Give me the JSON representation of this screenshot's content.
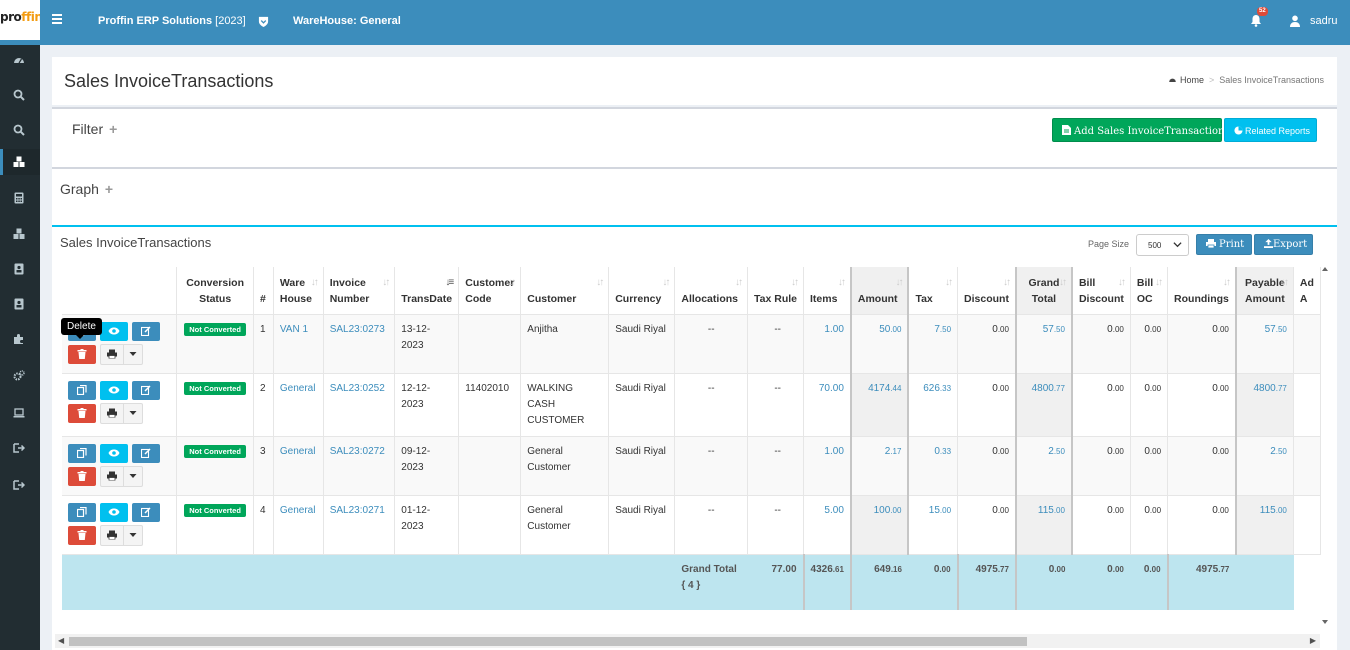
{
  "topbar": {
    "logo_a": "pro",
    "logo_b": "ffin",
    "title": "Proffin ERP Solutions",
    "year": "[2023]",
    "warehouse": "WareHouse: General",
    "notifications": "52",
    "user": "sadru"
  },
  "sidebar": {
    "icons": [
      "dashboard-icon",
      "search-icon",
      "search-icon",
      "cubes-icon",
      "calculator-icon",
      "cubes-icon",
      "id-card-icon",
      "id-card-icon",
      "puzzle-icon",
      "cogs-icon",
      "laptop-icon",
      "sign-out-icon",
      "sign-out-icon"
    ]
  },
  "header": {
    "title": "Sales InvoiceTransactions",
    "breadcrumb_home": "Home",
    "breadcrumb_sep": ">",
    "breadcrumb_current": "Sales InvoiceTransactions"
  },
  "filter": {
    "title": "Filter",
    "plus": "+",
    "add_button": "Add Sales InvoiceTransactions",
    "reports_button": "Related Reports"
  },
  "graph": {
    "title": "Graph",
    "plus": "+"
  },
  "table_box": {
    "title": "Sales InvoiceTransactions",
    "page_size_label": "Page Size",
    "page_size": "500",
    "print": "Print",
    "export": "Export",
    "tooltip": "Delete"
  },
  "columns": {
    "conversion_status": "Conversion Status",
    "no": "#",
    "warehouse": "Ware House",
    "invoice_number": "Invoice Number",
    "trans_date": "TransDate",
    "customer_code": "Customer Code",
    "customer": "Customer",
    "currency": "Currency",
    "allocations": "Allocations",
    "tax_rule": "Tax Rule",
    "items": "Items",
    "amount": "Amount",
    "tax": "Tax",
    "discount": "Discount",
    "grand_total": "Grand Total",
    "bill_discount": "Bill Discount",
    "bill_oc": "Bill OC",
    "roundings": "Roundings",
    "payable_amount": "Payable Amount",
    "ad": "Ad A"
  },
  "rows": [
    {
      "status": "Not Converted",
      "no": "1",
      "warehouse": "VAN 1",
      "invoice": "SAL23:0273",
      "date": "13-12-2023",
      "code": "",
      "customer": "Anjitha",
      "currency": "Saudi Riyal",
      "allocations": "--",
      "tax_rule": "--",
      "items": "1.00",
      "amount_int": "50",
      "amount_dec": ".00",
      "tax_int": "7",
      "tax_dec": ".50",
      "discount_int": "0",
      "discount_dec": ".00",
      "grand_int": "57",
      "grand_dec": ".50",
      "bill_discount_int": "0",
      "bill_discount_dec": ".00",
      "bill_oc_int": "0",
      "bill_oc_dec": ".00",
      "roundings_int": "0",
      "roundings_dec": ".00",
      "payable_int": "57",
      "payable_dec": ".50"
    },
    {
      "status": "Not Converted",
      "no": "2",
      "warehouse": "General",
      "invoice": "SAL23:0252",
      "date": "12-12-2023",
      "code": "11402010",
      "customer": "WALKING CASH CUSTOMER",
      "currency": "Saudi Riyal",
      "allocations": "--",
      "tax_rule": "--",
      "items": "70.00",
      "amount_int": "4174",
      "amount_dec": ".44",
      "tax_int": "626",
      "tax_dec": ".33",
      "discount_int": "0",
      "discount_dec": ".00",
      "grand_int": "4800",
      "grand_dec": ".77",
      "bill_discount_int": "0",
      "bill_discount_dec": ".00",
      "bill_oc_int": "0",
      "bill_oc_dec": ".00",
      "roundings_int": "0",
      "roundings_dec": ".00",
      "payable_int": "4800",
      "payable_dec": ".77"
    },
    {
      "status": "Not Converted",
      "no": "3",
      "warehouse": "General",
      "invoice": "SAL23:0272",
      "date": "09-12-2023",
      "code": "",
      "customer": "General Customer",
      "currency": "Saudi Riyal",
      "allocations": "--",
      "tax_rule": "--",
      "items": "1.00",
      "amount_int": "2",
      "amount_dec": ".17",
      "tax_int": "0",
      "tax_dec": ".33",
      "discount_int": "0",
      "discount_dec": ".00",
      "grand_int": "2",
      "grand_dec": ".50",
      "bill_discount_int": "0",
      "bill_discount_dec": ".00",
      "bill_oc_int": "0",
      "bill_oc_dec": ".00",
      "roundings_int": "0",
      "roundings_dec": ".00",
      "payable_int": "2",
      "payable_dec": ".50"
    },
    {
      "status": "Not Converted",
      "no": "4",
      "warehouse": "General",
      "invoice": "SAL23:0271",
      "date": "01-12-2023",
      "code": "",
      "customer": "General Customer",
      "currency": "Saudi Riyal",
      "allocations": "--",
      "tax_rule": "--",
      "items": "5.00",
      "amount_int": "100",
      "amount_dec": ".00",
      "tax_int": "15",
      "tax_dec": ".00",
      "discount_int": "0",
      "discount_dec": ".00",
      "grand_int": "115",
      "grand_dec": ".00",
      "bill_discount_int": "0",
      "bill_discount_dec": ".00",
      "bill_oc_int": "0",
      "bill_oc_dec": ".00",
      "roundings_int": "0",
      "roundings_dec": ".00",
      "payable_int": "115",
      "payable_dec": ".00"
    }
  ],
  "totals": {
    "label": "Grand Total { 4 }",
    "items": "77.00",
    "amount_int": "4326",
    "amount_dec": ".61",
    "tax_int": "649",
    "tax_dec": ".16",
    "discount_int": "0",
    "discount_dec": ".00",
    "grand_int": "4975",
    "grand_dec": ".77",
    "bill_discount_int": "0",
    "bill_discount_dec": ".00",
    "bill_oc_int": "0",
    "bill_oc_dec": ".00",
    "roundings_int": "0",
    "roundings_dec": ".00",
    "payable_int": "4975",
    "payable_dec": ".77"
  },
  "colors": {
    "primary": "#3c8dbc",
    "success": "#00a65a",
    "info": "#00c0ef",
    "danger": "#dd4b39",
    "sidebar": "#222d32",
    "total_row": "#bde5ef"
  }
}
